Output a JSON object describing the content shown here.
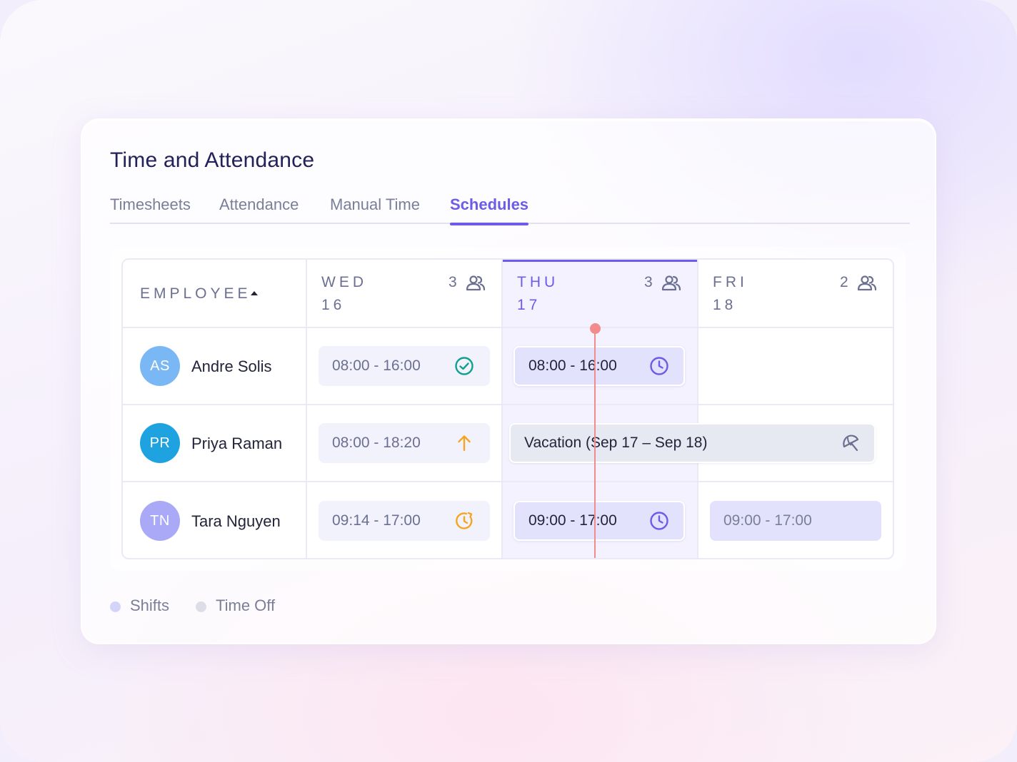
{
  "app": {
    "title": "Time and Attendance"
  },
  "tabs": [
    {
      "label": "Timesheets",
      "active": false
    },
    {
      "label": "Attendance",
      "active": false
    },
    {
      "label": "Manual Time",
      "active": false
    },
    {
      "label": "Schedules",
      "active": true
    }
  ],
  "schedule": {
    "employee_header": "EMPLOYEE",
    "days": [
      {
        "dow": "WED",
        "date": "16",
        "count": "3",
        "active": false
      },
      {
        "dow": "THU",
        "date": "17",
        "count": "3",
        "active": true
      },
      {
        "dow": "FRI",
        "date": "18",
        "count": "2",
        "active": false
      }
    ],
    "employees": [
      {
        "initials": "AS",
        "name": "Andre Solis",
        "avatar_color": "#7ab8f5",
        "shifts": [
          {
            "time": "08:00 - 16:00",
            "icon": "check-circle-icon"
          },
          {
            "time": "08:00 - 16:00",
            "icon": "clock-icon"
          }
        ]
      },
      {
        "initials": "PR",
        "name": "Priya Raman",
        "avatar_color": "#1fa3e0",
        "shifts": [
          {
            "time": "08:00 - 18:20",
            "icon": "arrow-up-icon"
          }
        ],
        "time_off": {
          "label": "Vacation (Sep 17 – Sep 18)",
          "icon": "umbrella-icon"
        }
      },
      {
        "initials": "TN",
        "name": "Tara Nguyen",
        "avatar_color": "#a9a9f7",
        "shifts": [
          {
            "time": "09:14 - 17:00",
            "icon": "late-clock-icon"
          },
          {
            "time": "09:00 - 17:00",
            "icon": "clock-icon"
          },
          {
            "time": "09:00 - 17:00",
            "icon": ""
          }
        ]
      }
    ]
  },
  "legend": [
    {
      "label": "Shifts",
      "color": "#d4d4fa"
    },
    {
      "label": "Time Off",
      "color": "#dcdde6"
    }
  ],
  "colors": {
    "accent": "#6c5ce7",
    "success": "#13a08f",
    "warning": "#f5a524",
    "now_line": "#f28b8b"
  }
}
